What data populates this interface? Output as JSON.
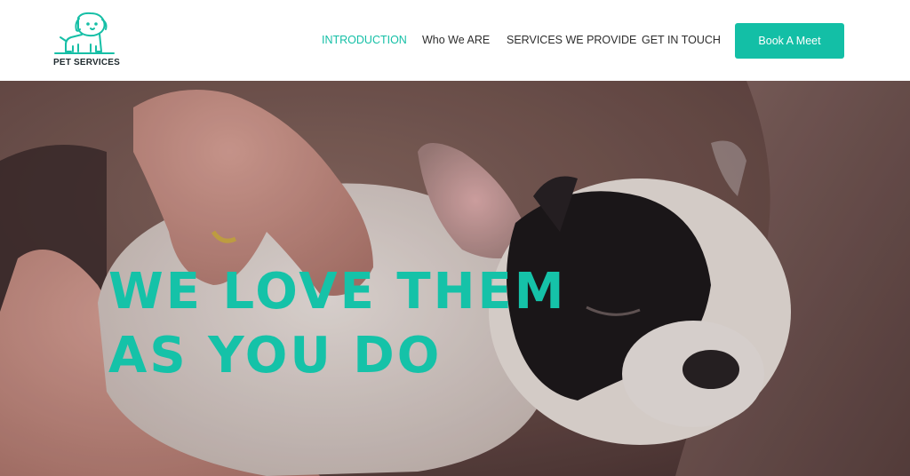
{
  "brand": {
    "name": "PET SERVICES",
    "logo_icon": "dog-icon",
    "accent": "#14bfa6"
  },
  "nav": {
    "items": [
      {
        "label": "INTRODUCTION",
        "active": true
      },
      {
        "label": "Who We ARE",
        "active": false
      },
      {
        "label": "SERVICES WE PROVIDE",
        "active": false
      },
      {
        "label": "GET IN TOUCH",
        "active": false
      }
    ],
    "cta_label": "Book A Meet"
  },
  "hero": {
    "title_line1": "WE LOVE THEM",
    "title_line2": "AS YOU DO",
    "image": "sleeping-puppy-photo"
  }
}
